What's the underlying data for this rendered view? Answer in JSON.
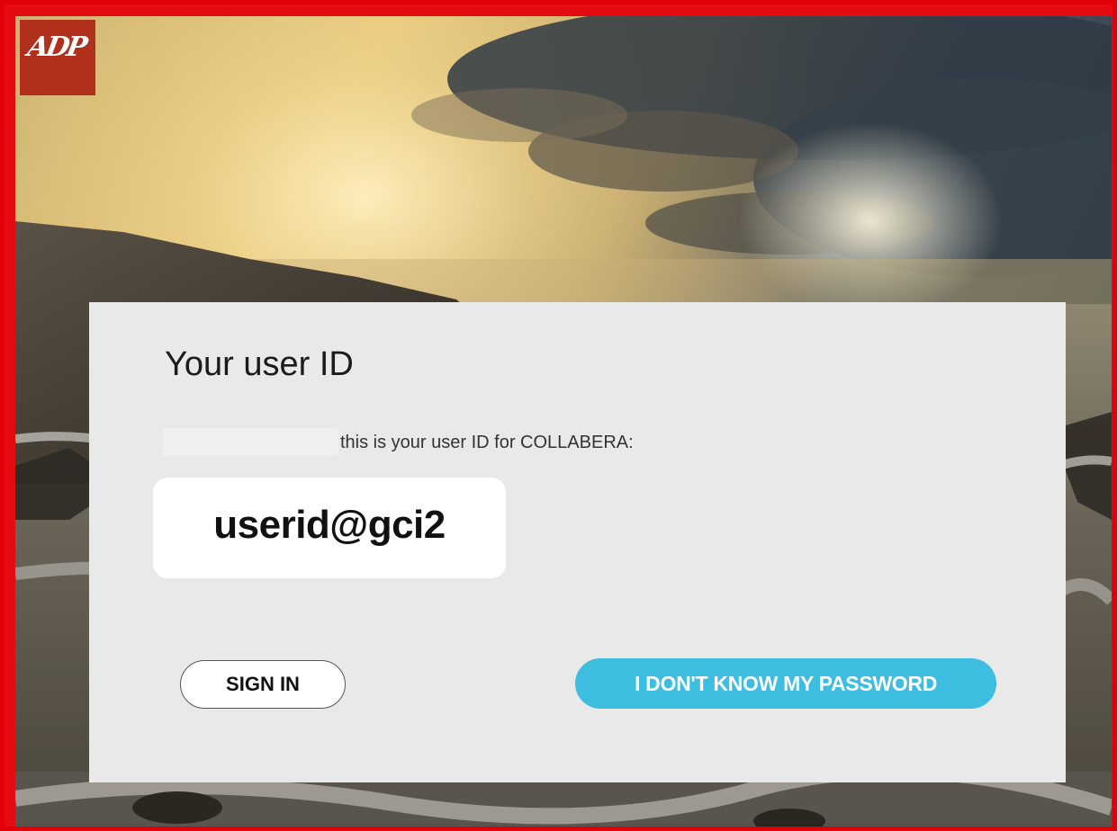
{
  "brand": {
    "logo_text": "ADP",
    "logo_color": "#b0301c",
    "frame_color": "#e0000a"
  },
  "card": {
    "title": "Your user ID",
    "info_text": "this is your user ID for COLLABERA:",
    "user_id": "userid@gci2"
  },
  "actions": {
    "sign_in_label": "SIGN IN",
    "forgot_password_label": "I DON'T KNOW MY PASSWORD",
    "forgot_button_color": "#3dbde0"
  }
}
